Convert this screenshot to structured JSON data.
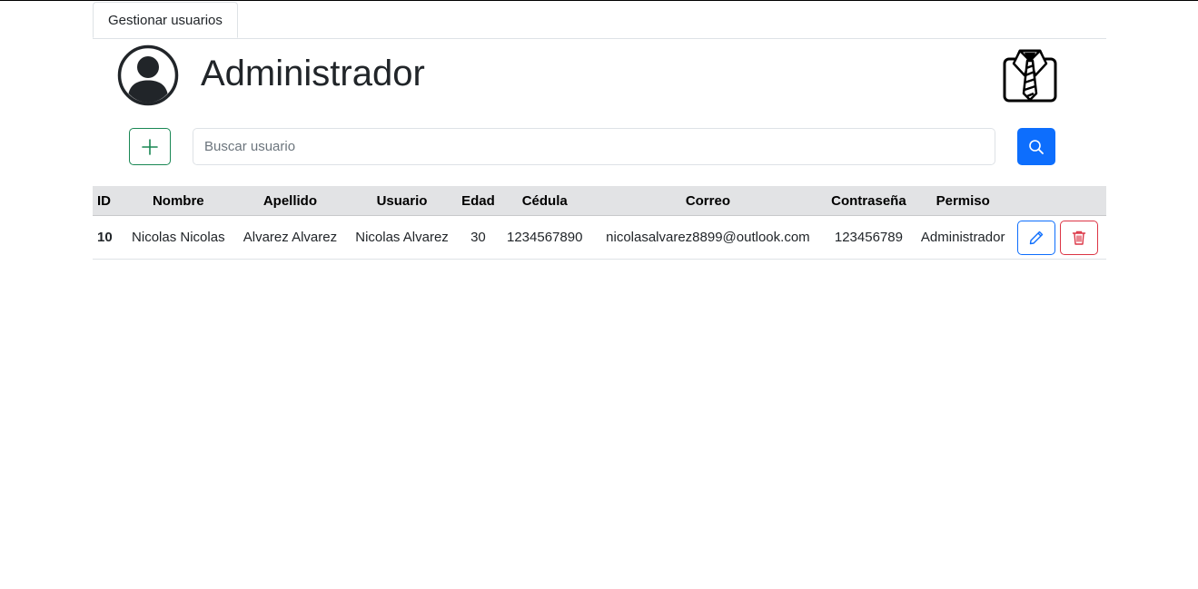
{
  "tabs": [
    {
      "label": "Gestionar usuarios"
    }
  ],
  "header": {
    "title": "Administrador"
  },
  "toolbar": {
    "search_placeholder": "Buscar usuario"
  },
  "table": {
    "columns": [
      "ID",
      "Nombre",
      "Apellido",
      "Usuario",
      "Edad",
      "Cédula",
      "Correo",
      "Contraseña",
      "Permiso"
    ],
    "rows": [
      {
        "id": "10",
        "nombre": "Nicolas Nicolas",
        "apellido": "Alvarez Alvarez",
        "usuario": "Nicolas Alvarez",
        "edad": "30",
        "cedula": "1234567890",
        "correo": "nicolasalvarez8899@outlook.com",
        "contrasena": "123456789",
        "permiso": "Administrador"
      }
    ]
  },
  "icons": {
    "avatar": "user-circle-icon",
    "brand": "shirt-tie-icon",
    "add": "plus-icon",
    "search": "search-icon",
    "edit": "pencil-icon",
    "delete": "trash-icon"
  },
  "colors": {
    "primary": "#0d6efd",
    "success": "#198754",
    "danger": "#dc3545",
    "header_bg": "#e2e3e5"
  }
}
